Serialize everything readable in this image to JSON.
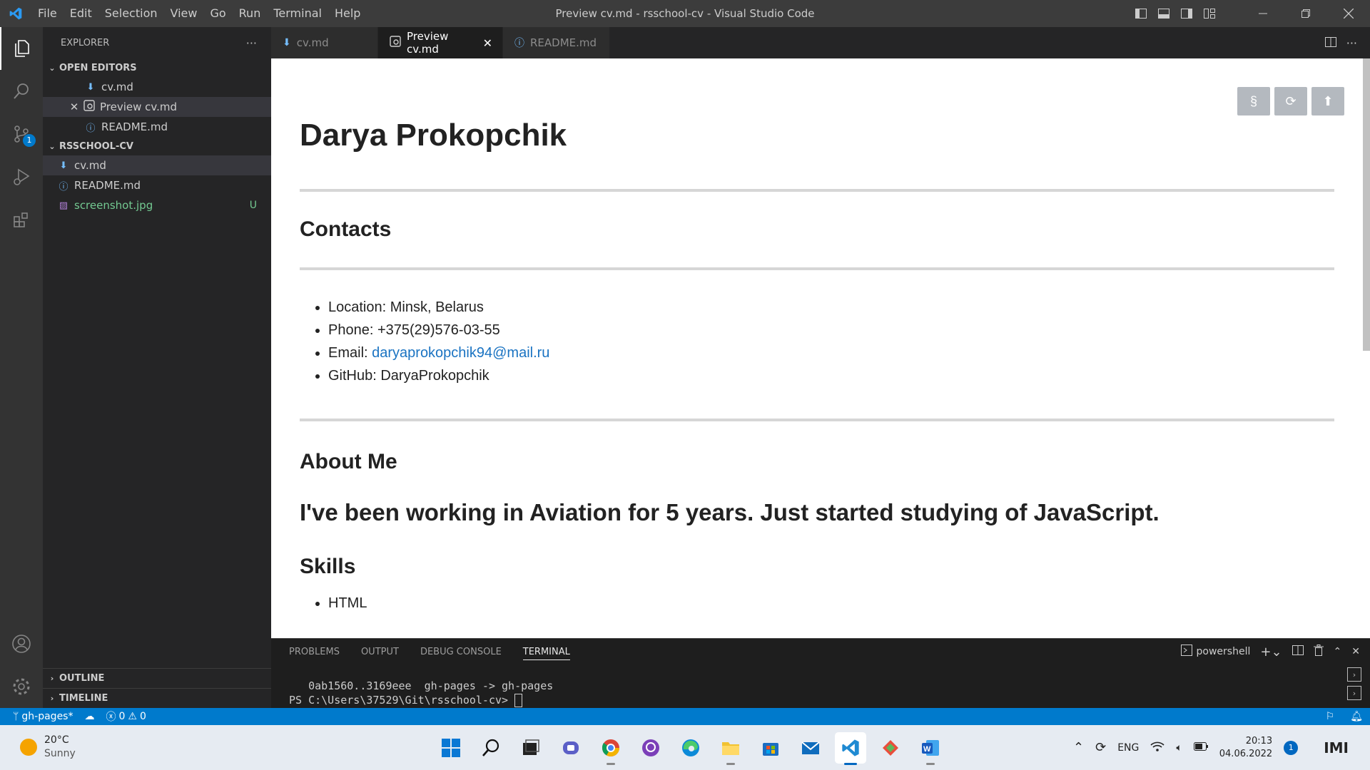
{
  "window": {
    "title": "Preview cv.md - rsschool-cv - Visual Studio Code",
    "menu": [
      "File",
      "Edit",
      "Selection",
      "View",
      "Go",
      "Run",
      "Terminal",
      "Help"
    ]
  },
  "activity_bar": {
    "items": [
      "explorer-icon",
      "search-icon",
      "source-control-icon",
      "run-debug-icon",
      "extensions-icon",
      "accounts-icon",
      "manage-gear-icon"
    ],
    "source_control_badge": "1"
  },
  "sidebar": {
    "title": "EXPLORER",
    "more": "···",
    "open_editors": {
      "label": "OPEN EDITORS",
      "items": [
        {
          "name": "cv.md",
          "icon": "markdown-icon"
        },
        {
          "name": "Preview cv.md",
          "icon": "preview-icon",
          "selected": true
        },
        {
          "name": "README.md",
          "icon": "info-icon"
        }
      ]
    },
    "folder": {
      "label": "RSSCHOOL-CV",
      "items": [
        {
          "name": "cv.md",
          "icon": "markdown-icon",
          "selected": true
        },
        {
          "name": "README.md",
          "icon": "info-icon"
        },
        {
          "name": "screenshot.jpg",
          "icon": "image-icon",
          "status": "U"
        }
      ]
    },
    "outline": "OUTLINE",
    "timeline": "TIMELINE"
  },
  "tabs": [
    {
      "label": "cv.md",
      "active": false
    },
    {
      "label": "Preview cv.md",
      "active": true
    },
    {
      "label": "README.md",
      "active": false
    }
  ],
  "preview": {
    "buttons": [
      "§",
      "⟳",
      "⬆"
    ],
    "h1": "Darya Prokopchik",
    "contacts_heading": "Contacts",
    "contacts": {
      "location": "Location: Minsk, Belarus",
      "phone": "Phone: +375(29)576-03-55",
      "email_prefix": "Email: ",
      "email": "daryaprokopchik94@mail.ru",
      "github": "GitHub: DaryaProkopchik"
    },
    "about_heading": "About Me",
    "about_text": "I've been working in Aviation for 5 years. Just started studying of JavaScript.",
    "skills_heading": "Skills",
    "skills": [
      "HTML"
    ]
  },
  "panel": {
    "tabs": [
      "PROBLEMS",
      "OUTPUT",
      "DEBUG CONSOLE",
      "TERMINAL"
    ],
    "active_tab": "TERMINAL",
    "shell": "powershell",
    "terminal_lines": [
      "   0ab1560..3169eee  gh-pages -> gh-pages",
      "PS C:\\Users\\37529\\Git\\rsschool-cv> "
    ]
  },
  "status_bar": {
    "branch": "gh-pages*",
    "errors": "0",
    "warnings": "0"
  },
  "taskbar": {
    "weather_temp": "20°C",
    "weather_desc": "Sunny",
    "language": "ENG",
    "time": "20:13",
    "date": "04.06.2022",
    "notification_count": "1"
  },
  "colors": {
    "accent": "#007acc",
    "untracked": "#73c991",
    "link": "#1a73c2"
  }
}
